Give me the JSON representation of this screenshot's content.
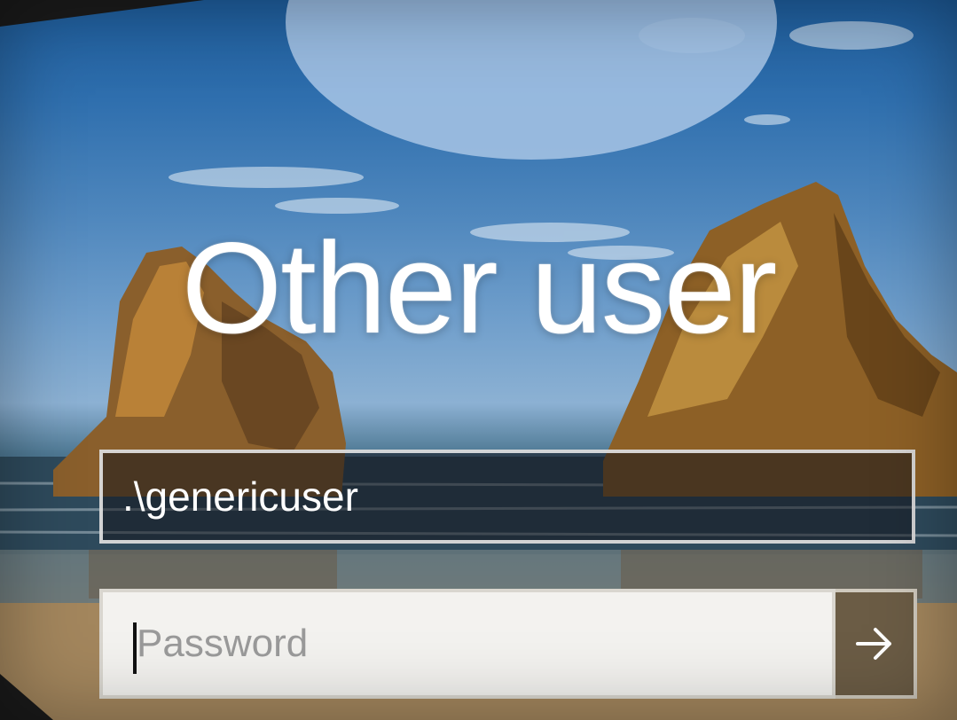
{
  "login": {
    "title": "Other user",
    "username": {
      "value": ".\\genericuser"
    },
    "password": {
      "placeholder": "Password",
      "value": ""
    },
    "submit": {
      "icon": "arrow-right-icon"
    }
  },
  "background": {
    "description_icon": "beach-rocks-wallpaper",
    "colors": {
      "sky": "#2f6fae",
      "sea": "#2f4f66",
      "sand": "#a88a60",
      "rock": "#9a6a2c"
    }
  },
  "avatar": {
    "icon": "user-avatar-icon",
    "color": "#9fbfe2"
  }
}
